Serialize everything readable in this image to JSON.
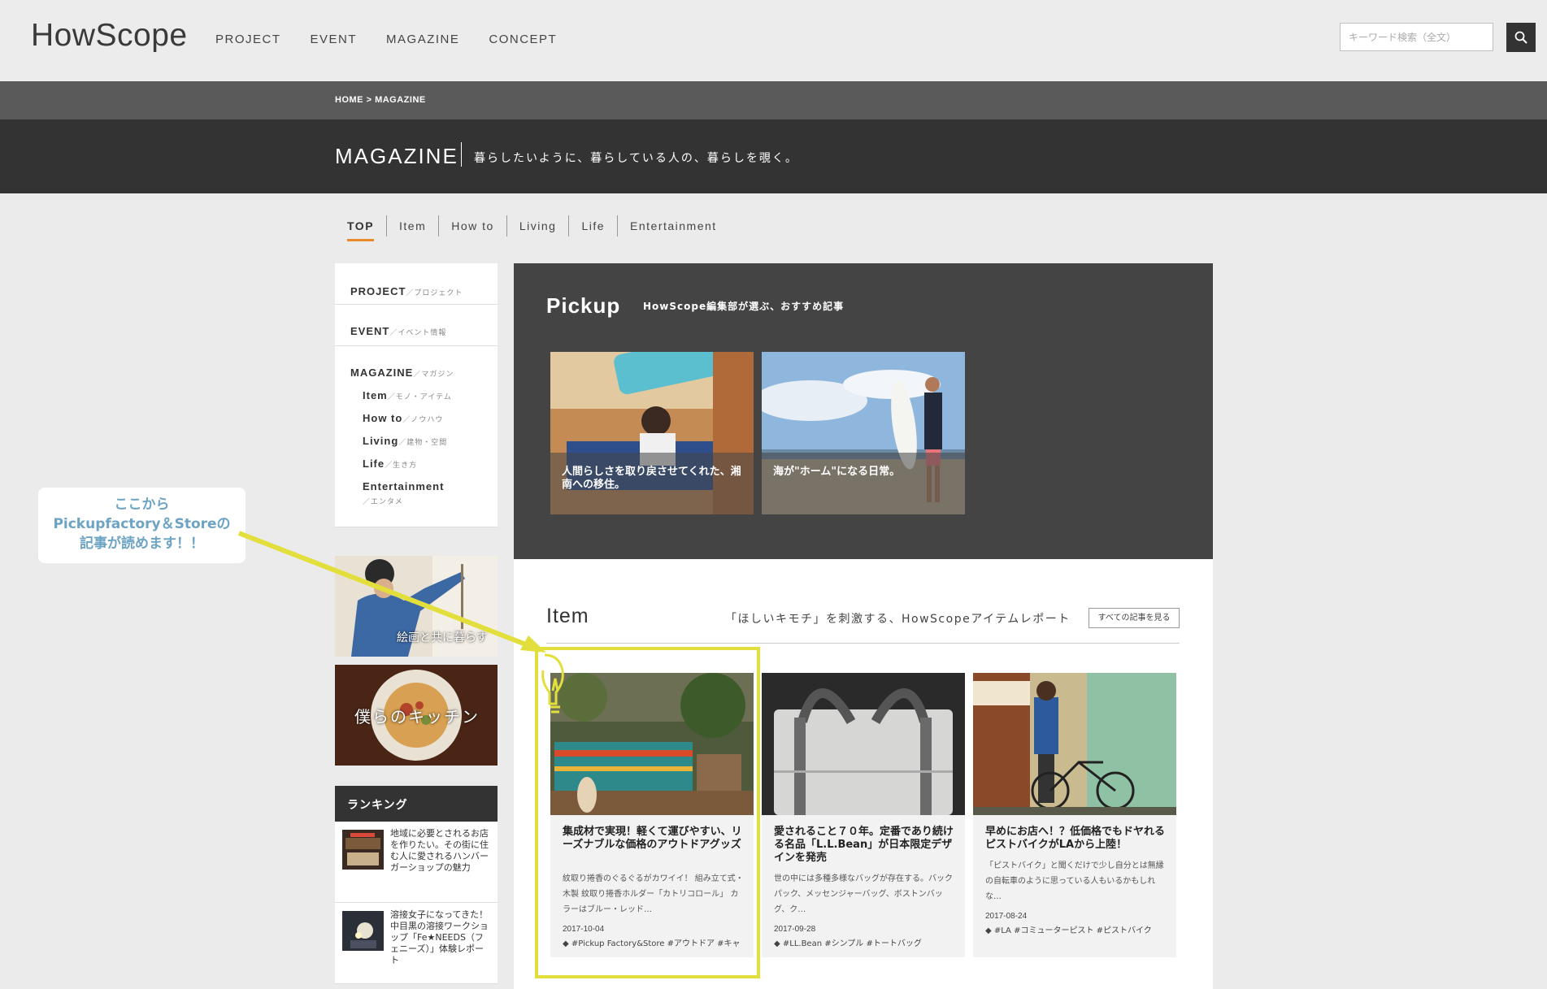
{
  "header": {
    "logo": "HowScope",
    "nav": [
      "PROJECT",
      "EVENT",
      "MAGAZINE",
      "CONCEPT"
    ],
    "search_placeholder": "キーワード検索（全文）"
  },
  "breadcrumb": {
    "home": "HOME",
    "sep": ">",
    "current": "MAGAZINE"
  },
  "page": {
    "title": "MAGAZINE",
    "subtitle": "暮らしたいように、暮らしている人の、暮らしを覗く。"
  },
  "subtabs": [
    "TOP",
    "Item",
    "How to",
    "Living",
    "Life",
    "Entertainment"
  ],
  "sidebar": {
    "project": {
      "label": "PROJECT",
      "sub": "／プロジェクト"
    },
    "event": {
      "label": "EVENT",
      "sub": "／イベント情報"
    },
    "magazine": {
      "label": "MAGAZINE",
      "sub": "／マガジン"
    },
    "children": [
      {
        "label": "Item",
        "sub": "／モノ・アイテム"
      },
      {
        "label": "How to",
        "sub": "／ノウハウ"
      },
      {
        "label": "Living",
        "sub": "／建物・空間"
      },
      {
        "label": "Life",
        "sub": "／生き方"
      },
      {
        "label": "Entertainment",
        "sub": "／エンタメ"
      }
    ],
    "banner1": "絵画と共に暮らす",
    "banner2": "僕らのキッチン",
    "ranking_title": "ランキング",
    "ranking": [
      "地域に必要とされるお店を作りたい。その街に住む人に愛されるハンバーガーショップの魅力",
      "溶接女子になってきた！中目黒の溶接ワークショップ「Fe★NEEDS（フェニーズ）」体験レポート"
    ]
  },
  "pickup": {
    "title": "Pickup",
    "subtitle": "HowScope編集部が選ぶ、おすすめ記事",
    "cards": [
      "人間らしさを取り戻させてくれた、湘南への移住。",
      "海が\"ホーム\"になる日常。"
    ]
  },
  "item": {
    "title": "Item",
    "subtitle": "「ほしいキモチ」を刺激する、HowScopeアイテムレポート",
    "all_button": "すべての記事を見る",
    "cards": [
      {
        "title": "集成材で実現！軽くて運びやすい、リーズナブルな価格のアウトドアグッズ",
        "desc": "紋取り捲香のぐるぐるがカワイイ！ 組み立て式・木製 紋取り捲香ホルダー「カトリコロール」 カラーはブルー・レッド…",
        "date": "2017-10-04",
        "tags": "#Pickup Factory&Store #アウトドア #キャンプ"
      },
      {
        "title": "愛されること７０年。定番であり続ける名品「L.L.Bean」が日本限定デザインを発売",
        "desc": "世の中には多種多様なバッグが存在する。バックパック、メッセンジャーバッグ、ボストンバッグ、ク…",
        "date": "2017-09-28",
        "tags": "#LL.Bean #シンプル #トートバッグ"
      },
      {
        "title": "早めにお店へ！？低価格でもドヤれるピストバイクがLAから上陸！",
        "desc": "「ピストバイク」と聞くだけで少し自分とは無縁の自転車のように思っている人もいるかもしれな…",
        "date": "2017-08-24",
        "tags": "#LA #コミューターピスト #ピストバイク"
      }
    ]
  },
  "annotation": {
    "line1": "ここから",
    "line2": "Pickupfactory＆Storeの",
    "line3": "記事が読めます！！"
  },
  "colors": {
    "accent": "#e8892a",
    "highlight": "#e2df3c",
    "annotation_text": "#6da3c3"
  }
}
